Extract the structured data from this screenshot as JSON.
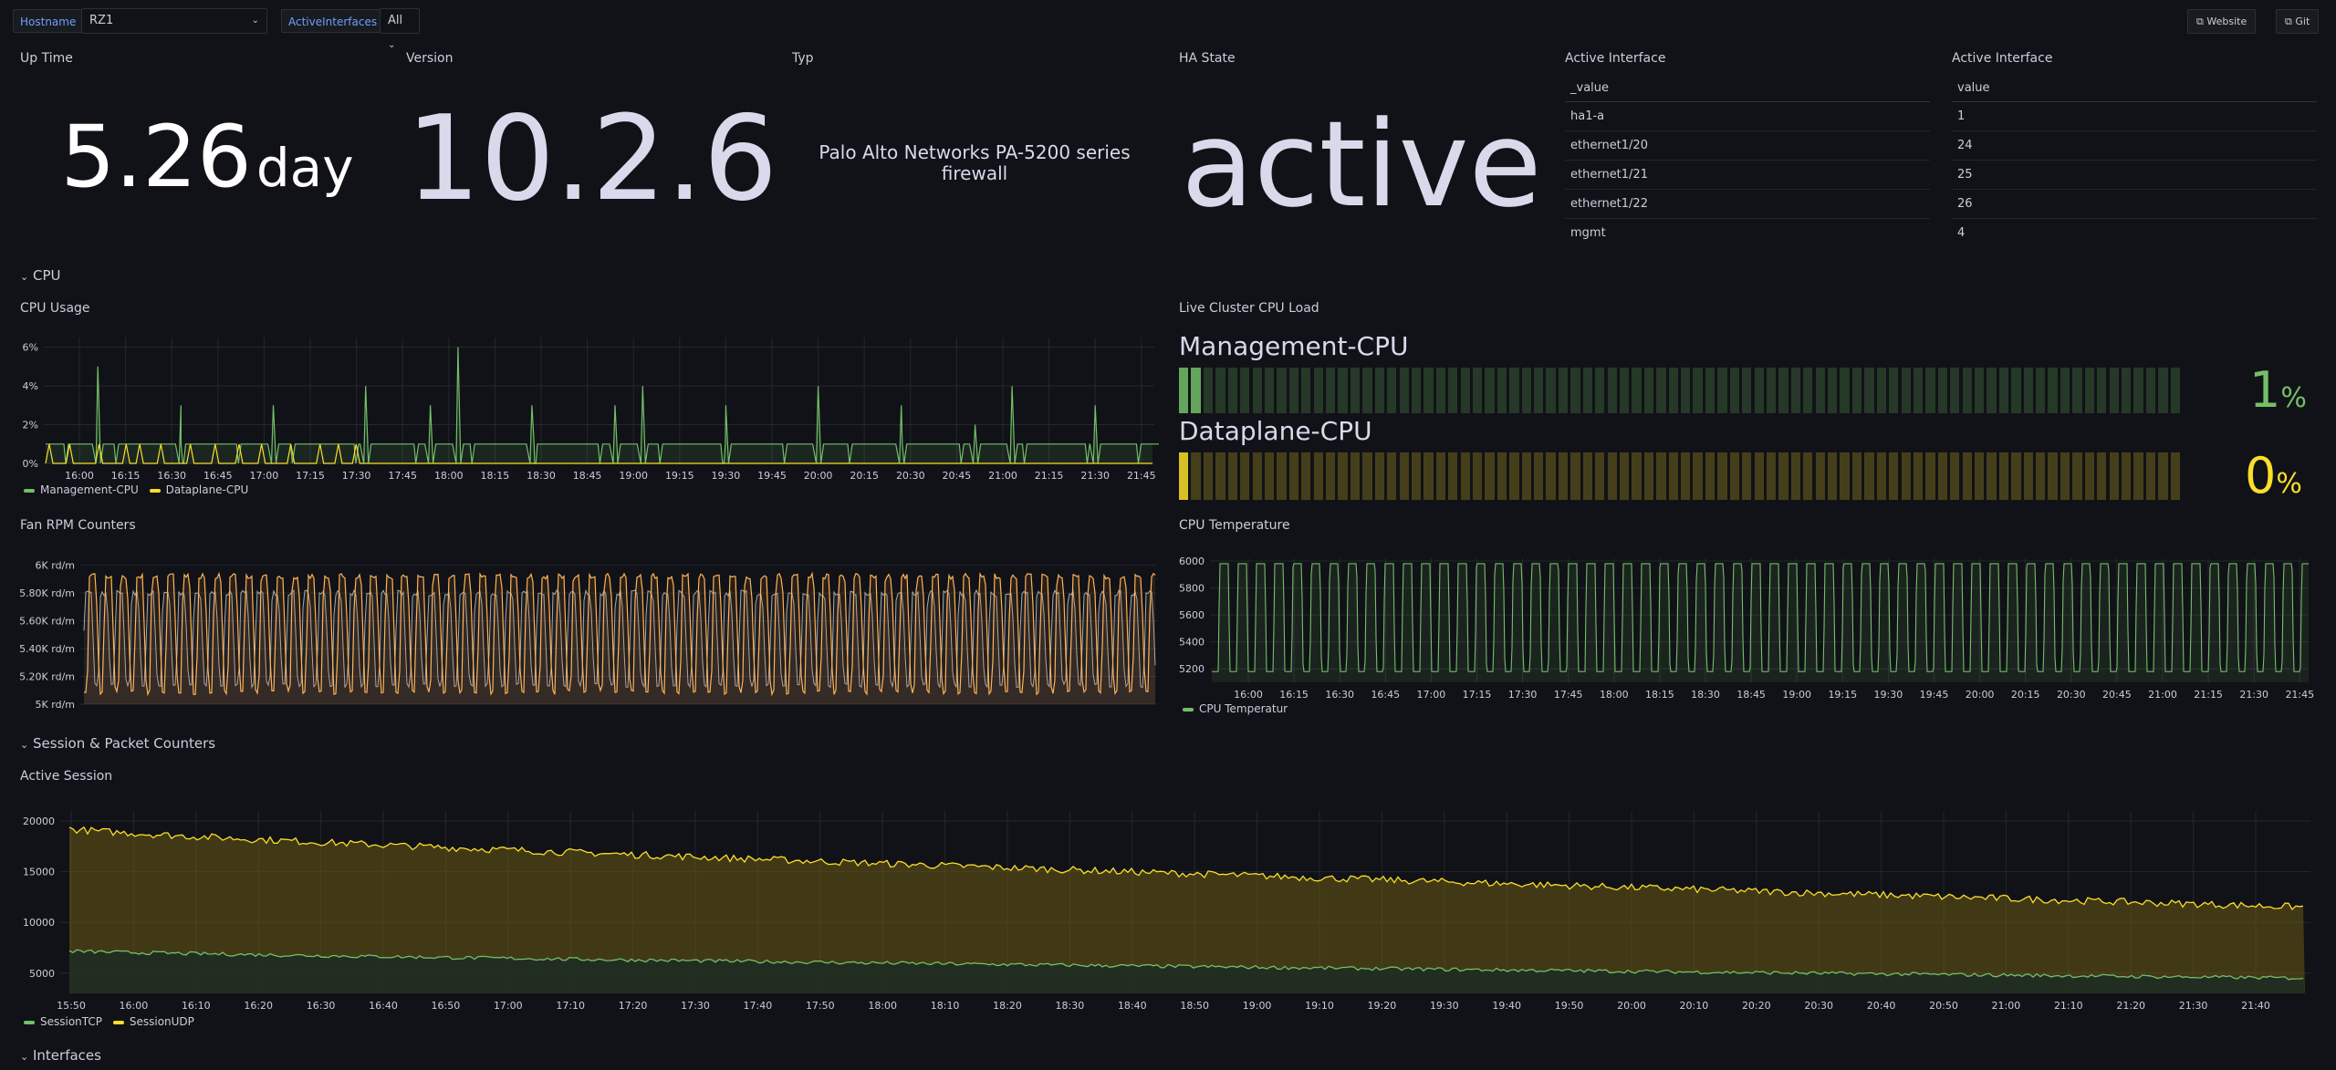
{
  "toolbar": {
    "hostname_label": "Hostname",
    "hostname_value": "RZ1",
    "interfaces_label": "ActiveInterfaces",
    "interfaces_value": "All",
    "website_label": "Website",
    "git_label": "Git"
  },
  "stats": {
    "uptime": {
      "title": "Up Time",
      "value": "5.26",
      "unit": "day"
    },
    "version": {
      "title": "Version",
      "value": "10.2.6"
    },
    "typ": {
      "title": "Typ",
      "value": "Palo Alto Networks PA-5200 series firewall"
    },
    "ha": {
      "title": "HA State",
      "value": "active"
    }
  },
  "iface_table1": {
    "title": "Active Interface",
    "header": "_value",
    "rows": [
      "ha1-a",
      "ethernet1/20",
      "ethernet1/21",
      "ethernet1/22",
      "mgmt"
    ]
  },
  "iface_table2": {
    "title": "Active Interface",
    "header": "value",
    "rows": [
      "1",
      "24",
      "25",
      "26",
      "4"
    ]
  },
  "rows": {
    "cpu": "CPU",
    "session": "Session & Packet Counters",
    "interfaces": "Interfaces"
  },
  "panels": {
    "cpu_usage": "CPU Usage",
    "cluster_cpu": "Live Cluster CPU Load",
    "fan_rpm": "Fan RPM Counters",
    "cpu_temp": "CPU Temperature",
    "active_session": "Active Session"
  },
  "bargauge": {
    "mgmt_name": "Management-CPU",
    "mgmt_value": "1",
    "mgmt_unit": "%",
    "mgmt_level": 0.01,
    "dp_name": "Dataplane-CPU",
    "dp_value": "0",
    "dp_unit": "%",
    "dp_level": 0.0,
    "green": "#73bf69",
    "yellow": "#fade2a"
  },
  "legends": {
    "cpu": [
      "Management-CPU",
      "Dataplane-CPU"
    ],
    "temp": [
      "CPU Temperatur"
    ],
    "session": [
      "SessionTCP",
      "SessionUDP"
    ]
  },
  "colors": {
    "green": "#73bf69",
    "yellow": "#fade2a",
    "orange": "#ff9830",
    "background": "#111217",
    "grid": "#25272d"
  },
  "chart_data": [
    {
      "type": "line",
      "title": "CPU Usage",
      "ytick_labels": [
        "0%",
        "2%",
        "4%",
        "6%"
      ],
      "ylim": [
        0,
        6.5
      ],
      "x": [
        "16:00",
        "16:15",
        "16:30",
        "16:45",
        "17:00",
        "17:15",
        "17:30",
        "17:45",
        "18:00",
        "18:15",
        "18:30",
        "18:45",
        "19:00",
        "19:15",
        "19:30",
        "19:45",
        "20:00",
        "20:15",
        "20:30",
        "20:45",
        "21:00",
        "21:15",
        "21:30",
        "21:45"
      ],
      "series": [
        {
          "name": "Management-CPU",
          "baseline": 1,
          "spikes": [
            [
              16.1,
              5
            ],
            [
              16.55,
              3
            ],
            [
              17.05,
              3
            ],
            [
              17.55,
              4
            ],
            [
              17.9,
              3
            ],
            [
              18.05,
              6
            ],
            [
              18.45,
              3
            ],
            [
              18.9,
              3
            ],
            [
              19.05,
              4
            ],
            [
              19.5,
              3
            ],
            [
              20.0,
              4
            ],
            [
              20.45,
              3
            ],
            [
              20.85,
              2
            ],
            [
              21.05,
              4
            ],
            [
              21.5,
              3
            ],
            [
              21.95,
              3
            ]
          ]
        },
        {
          "name": "Dataplane-CPU",
          "values_range": [
            0,
            1
          ]
        }
      ]
    },
    {
      "type": "line",
      "title": "Fan RPM Counters",
      "ytick_labels": [
        "5K rd/m",
        "5.20K rd/m",
        "5.40K rd/m",
        "5.60K rd/m",
        "5.80K rd/m",
        "6K rd/m"
      ],
      "ylim": [
        5000,
        6050
      ],
      "series": [
        {
          "name": "fan-orange",
          "values_range": [
            5070,
            5940
          ]
        },
        {
          "name": "fan-grey",
          "values_range": [
            5120,
            5820
          ]
        }
      ]
    },
    {
      "type": "line",
      "title": "CPU Temperature",
      "ytick_labels": [
        "5200",
        "5400",
        "5600",
        "5800",
        "6000"
      ],
      "ylim": [
        5100,
        6020
      ],
      "x": [
        "16:00",
        "16:15",
        "16:30",
        "16:45",
        "17:00",
        "17:15",
        "17:30",
        "17:45",
        "18:00",
        "18:15",
        "18:30",
        "18:45",
        "19:00",
        "19:15",
        "19:30",
        "19:45",
        "20:00",
        "20:15",
        "20:30",
        "20:45",
        "21:00",
        "21:15",
        "21:30",
        "21:45"
      ],
      "series": [
        {
          "name": "CPU Temperatur",
          "values_range": [
            5180,
            5980
          ]
        }
      ]
    },
    {
      "type": "area",
      "title": "Active Session",
      "ytick_labels": [
        "5000",
        "10000",
        "15000",
        "20000"
      ],
      "ylim": [
        3000,
        21000
      ],
      "x": [
        "15:50",
        "16:00",
        "16:10",
        "16:20",
        "16:30",
        "16:40",
        "16:50",
        "17:00",
        "17:10",
        "17:20",
        "17:30",
        "17:40",
        "17:50",
        "18:00",
        "18:10",
        "18:20",
        "18:30",
        "18:40",
        "18:50",
        "19:00",
        "19:10",
        "19:20",
        "19:30",
        "19:40",
        "19:50",
        "20:00",
        "20:10",
        "20:20",
        "20:30",
        "20:40",
        "20:50",
        "21:00",
        "21:10",
        "21:20",
        "21:30",
        "21:40"
      ],
      "series": [
        {
          "name": "SessionTCP",
          "start": 7200,
          "end": 4500
        },
        {
          "name": "SessionUDP",
          "start": 19300,
          "end": 11500
        }
      ]
    }
  ]
}
